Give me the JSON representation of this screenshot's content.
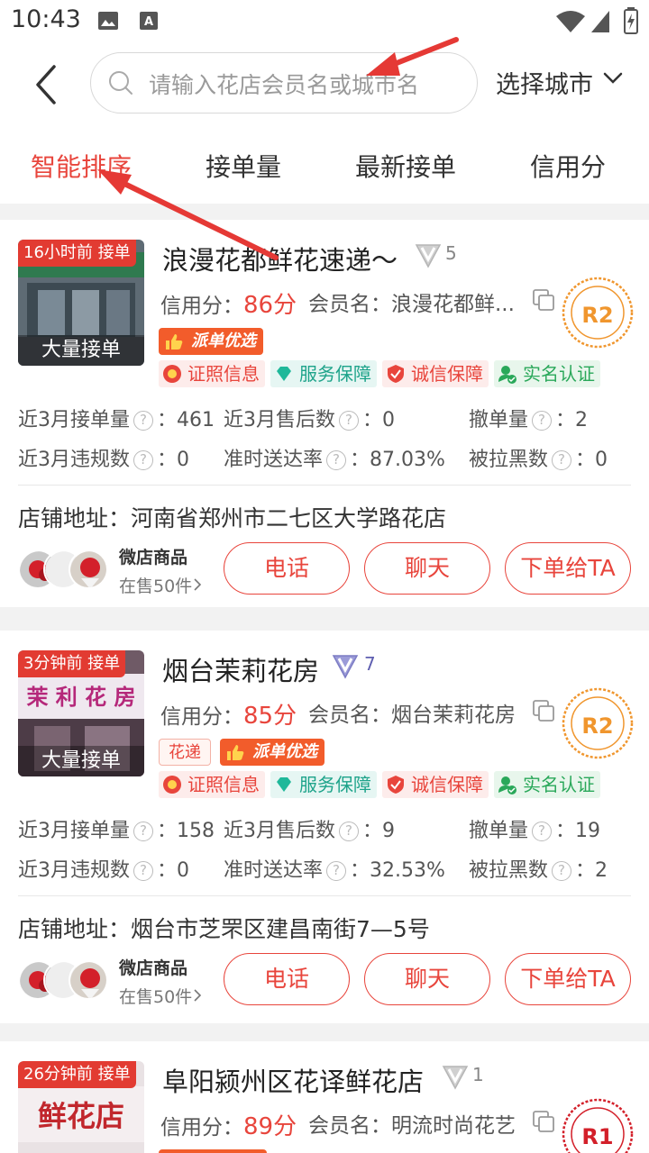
{
  "status_bar": {
    "time": "10:43"
  },
  "header": {
    "search_placeholder": "请输入花店会员名或城市名",
    "city_select": "选择城市"
  },
  "sort_tabs": [
    {
      "label": "智能排序",
      "active": true
    },
    {
      "label": "接单量",
      "active": false
    },
    {
      "label": "最新接单",
      "active": false
    },
    {
      "label": "信用分",
      "active": false
    }
  ],
  "shops": [
    {
      "time_badge": "16小时前 接单",
      "thumb_caption": "大量接单",
      "name": "浪漫花都鲜花速递～",
      "vip_level": "5",
      "credit_label": "信用分：",
      "credit_score": "86分",
      "member": "会员名：浪漫花都鲜...",
      "grade": "R2",
      "tags": [
        "派单优选"
      ],
      "certs": [
        "证照信息",
        "服务保障",
        "诚信保障",
        "实名认证"
      ],
      "stats": {
        "orders": "近3月接单量",
        "orders_val": "：461",
        "aftersales": "近3月售后数",
        "aftersales_val": "：0",
        "cancel": "撤单量",
        "cancel_val": "：2",
        "violations": "近3月违规数",
        "violations_val": "：0",
        "ontime": "准时送达率",
        "ontime_val": "：87.03%",
        "blacklist": "被拉黑数",
        "blacklist_val": "：0"
      },
      "address": "店铺地址：河南省郑州市二七区大学路花店",
      "products_title": "微店商品",
      "products_count": "在售50件"
    },
    {
      "time_badge": "3分钟前 接单",
      "thumb_caption": "大量接单",
      "name": "烟台茉莉花房",
      "vip_level": "7",
      "credit_label": "信用分：",
      "credit_score": "85分",
      "member": "会员名：烟台茉莉花房",
      "grade": "R2",
      "tags": [
        "花递",
        "派单优选"
      ],
      "certs": [
        "证照信息",
        "服务保障",
        "诚信保障",
        "实名认证"
      ],
      "stats": {
        "orders": "近3月接单量",
        "orders_val": "：158",
        "aftersales": "近3月售后数",
        "aftersales_val": "：9",
        "cancel": "撤单量",
        "cancel_val": "：19",
        "violations": "近3月违规数",
        "violations_val": "：0",
        "ontime": "准时送达率",
        "ontime_val": "：32.53%",
        "blacklist": "被拉黑数",
        "blacklist_val": "：2"
      },
      "address": "店铺地址：烟台市芝罘区建昌南街7—5号",
      "products_title": "微店商品",
      "products_count": "在售50件"
    },
    {
      "time_badge": "26分钟前 接单",
      "name": "阜阳颍州区花译鲜花店",
      "vip_level": "1",
      "credit_label": "信用分：",
      "credit_score": "89分",
      "member": "会员名：明流时尚花艺",
      "grade": "R1"
    }
  ],
  "buttons": {
    "call": "电话",
    "chat": "聊天",
    "order": "下单给TA"
  },
  "colors": {
    "accent": "#e8453c",
    "annotation_arrow": "#e53935"
  }
}
